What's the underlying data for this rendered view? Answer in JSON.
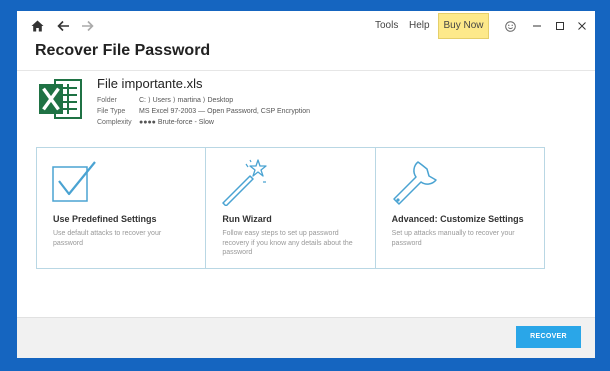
{
  "titlebar": {
    "tools_label": "Tools",
    "help_label": "Help",
    "buy_now_label": "Buy Now",
    "icons": [
      "home-icon",
      "back-arrow-icon",
      "forward-arrow-icon",
      "smiley-icon",
      "minimize-icon",
      "maximize-icon",
      "close-icon"
    ]
  },
  "page": {
    "title": "Recover File Password"
  },
  "file": {
    "name": "File importante.xls",
    "folder_label": "Folder",
    "folder_value": "C: ⟩ Users ⟩ martina ⟩ Desktop",
    "type_label": "File Type",
    "type_value": "MS Excel 97-2003 — Open Password, CSP Encryption",
    "complexity_label": "Complexity",
    "complexity_dots": "●●●●",
    "complexity_value": "Brute-force - Slow"
  },
  "options": [
    {
      "title": "Use Predefined Settings",
      "description": "Use default attacks to recover your password",
      "icon": "checkbox-icon"
    },
    {
      "title": "Run Wizard",
      "description": "Follow easy steps to set up password recovery if you know any details about the password",
      "icon": "magic-wand-icon"
    },
    {
      "title": "Advanced: Customize Settings",
      "description": "Set up attacks manually to recover your password",
      "icon": "wrench-icon"
    }
  ],
  "footer": {
    "recover_label": "RECOVER"
  },
  "colors": {
    "background": "#1565c0",
    "accent": "#2aa6e8",
    "buy_now": "#fde98a",
    "excel_green": "#1f7244",
    "option_border": "#b9d7e4"
  }
}
